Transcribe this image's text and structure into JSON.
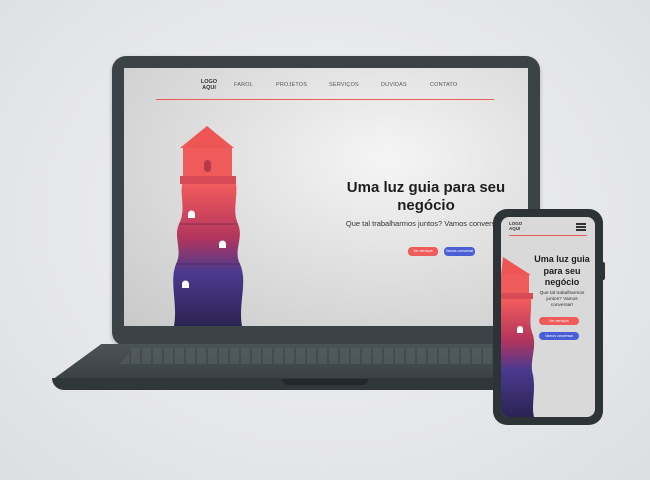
{
  "desktop_site": {
    "logo": "LOGO AQUI",
    "nav": [
      "FAROL",
      "PROJETOS",
      "SERVIÇOS",
      "DUVIDAS",
      "CONTATO"
    ],
    "headline": "Uma luz guia para seu negócio",
    "subtitle": "Que tal trabalharmos juntos? Vamos conversar!",
    "primary_button": "Ver serviços",
    "secondary_button": "Vamos conversar"
  },
  "mobile_site": {
    "logo": "LOGO AQUI",
    "menu_icon": "hamburger-icon",
    "headline": "Uma luz guia para seu negócio",
    "subtitle": "Que tal trabalharmos juntos? Vamos conversar!",
    "primary_button": "Ver serviços",
    "secondary_button": "Vamos conversar"
  },
  "colors": {
    "accent_red": "#ef5a5a",
    "accent_blue": "#4a5ed6",
    "lighthouse_top": "#ef5a5a",
    "lighthouse_bottom": "#2e2458",
    "device_frame": "#3c4347"
  }
}
